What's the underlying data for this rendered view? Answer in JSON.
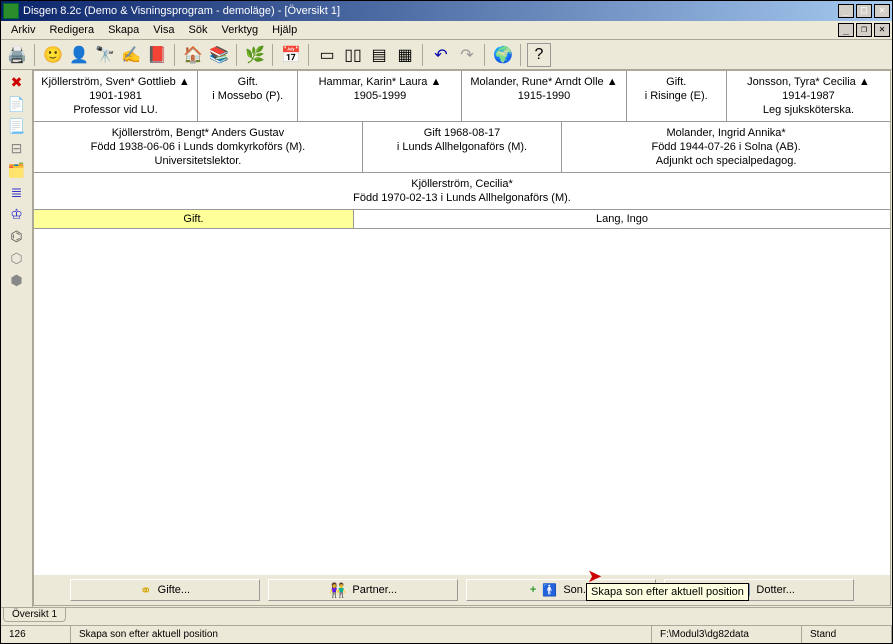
{
  "title": "Disgen 8.2c (Demo & Visningsprogram - demoläge) - [Översikt 1]",
  "menu": [
    "Arkiv",
    "Redigera",
    "Skapa",
    "Visa",
    "Sök",
    "Verktyg",
    "Hjälp"
  ],
  "toolbar_icons": [
    "print",
    "head",
    "star-person",
    "binoculars",
    "pencil",
    "book",
    "house",
    "multibook",
    "leaf",
    "calendar",
    "panel1",
    "panel2",
    "panel3",
    "panel4",
    "undo",
    "redo",
    "globe",
    "help"
  ],
  "sidebar_icons": [
    "close-x",
    "doc-red",
    "doc",
    "tree-h",
    "layers",
    "bars-blue",
    "crown",
    "org",
    "poly-up",
    "poly-down"
  ],
  "gen1": [
    {
      "line1": "Kjöllerström, Sven* Gottlieb ▲",
      "line2": "1901-1981",
      "line3": "Professor vid LU."
    },
    {
      "line1": "Gift.",
      "line2": "i Mossebo (P).",
      "line3": ""
    },
    {
      "line1": "Hammar, Karin* Laura ▲",
      "line2": "1905-1999",
      "line3": ""
    },
    {
      "line1": "Molander, Rune* Arndt Olle ▲",
      "line2": "1915-1990",
      "line3": ""
    },
    {
      "line1": "Gift.",
      "line2": "i Risinge (E).",
      "line3": ""
    },
    {
      "line1": "Jonsson, Tyra* Cecilia ▲",
      "line2": "1914-1987",
      "line3": "Leg sjuksköterska."
    }
  ],
  "gen2": [
    {
      "line1": "Kjöllerström, Bengt* Anders Gustav",
      "line2": "Född 1938-06-06 i Lunds domkyrkoförs (M).",
      "line3": "Universitetslektor."
    },
    {
      "line1": "Gift 1968-08-17",
      "line2": "i Lunds Allhelgonaförs (M).",
      "line3": ""
    },
    {
      "line1": "Molander, Ingrid Annika*",
      "line2": "Född 1944-07-26 i Solna (AB).",
      "line3": "Adjunkt och specialpedagog."
    }
  ],
  "center": {
    "line1": "Kjöllerström, Cecilia*",
    "line2": "Född 1970-02-13 i Lunds Allhelgonaförs (M)."
  },
  "relation": {
    "left": "Gift.",
    "right": "Lang, Ingo"
  },
  "buttons": {
    "gifte": "Gifte...",
    "partner": "Partner...",
    "son": "Son...",
    "dotter": "Dotter..."
  },
  "tab": "Översikt 1",
  "status": {
    "num": "126",
    "msg": "Skapa son efter aktuell position",
    "path": "F:\\Modul3\\dg82data",
    "mode": "Stand"
  },
  "tooltip": "Skapa son efter aktuell position"
}
